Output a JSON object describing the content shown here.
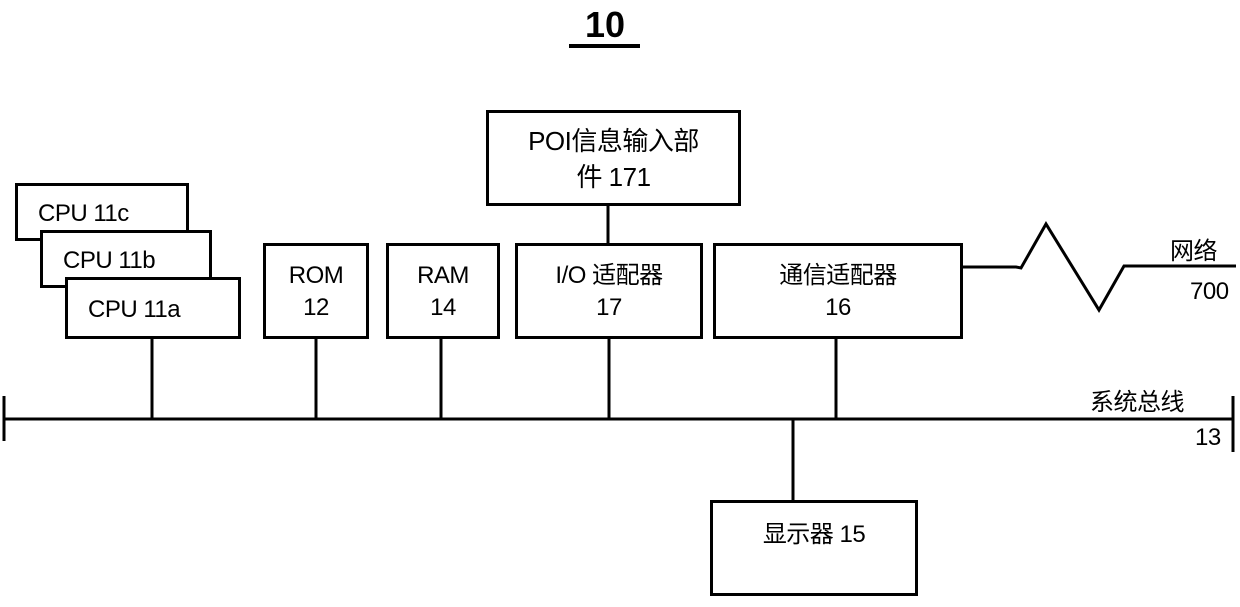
{
  "figure": {
    "title": "10",
    "components": {
      "poi": {
        "line1": "POI信息输入部",
        "line2": "件 171"
      },
      "cpu_c": {
        "label": "CPU 11c"
      },
      "cpu_b": {
        "label": "CPU 11b"
      },
      "cpu_a": {
        "label": "CPU 11a"
      },
      "rom": {
        "line1": "ROM",
        "line2": "12"
      },
      "ram": {
        "line1": "RAM",
        "line2": "14"
      },
      "io": {
        "line1": "I/O 适配器",
        "line2": "17"
      },
      "comm": {
        "line1": "通信适配器",
        "line2": "16"
      },
      "display": {
        "label": "显示器 15"
      }
    },
    "network": {
      "label": "网络",
      "ref": "700"
    },
    "bus": {
      "label": "系统总线",
      "ref": "13"
    }
  }
}
